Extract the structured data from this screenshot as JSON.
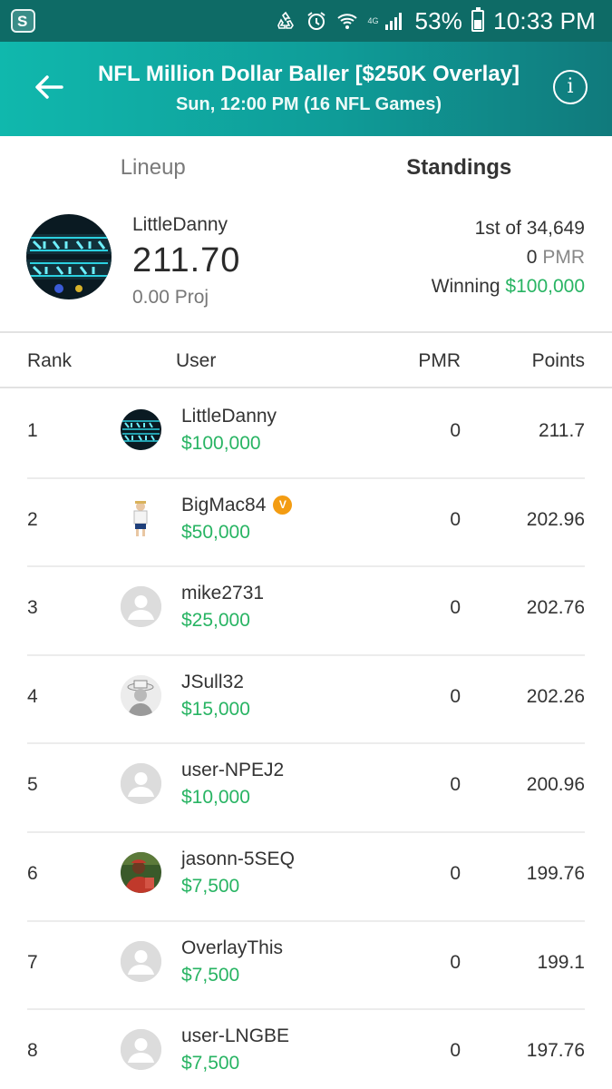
{
  "status_bar": {
    "battery": "53%",
    "time": "10:33 PM",
    "network_label": "4G",
    "icons": [
      "app-icon",
      "recycle-icon",
      "alarm-icon",
      "wifi-icon",
      "signal-icon",
      "battery-icon"
    ]
  },
  "header": {
    "title": "NFL Million Dollar Baller [$250K Overlay]",
    "subtitle": "Sun, 12:00 PM (16 NFL Games)"
  },
  "tabs": [
    {
      "label": "Lineup",
      "active": false
    },
    {
      "label": "Standings",
      "active": true
    }
  ],
  "summary": {
    "username": "LittleDanny",
    "score": "211.70",
    "proj": "0.00 Proj",
    "place": "1st of 34,649",
    "pmr_value": "0",
    "pmr_label": "PMR",
    "winning_label": "Winning",
    "winning_amount": "$100,000"
  },
  "table": {
    "headers": {
      "rank": "Rank",
      "user": "User",
      "pmr": "PMR",
      "points": "Points"
    },
    "rows": [
      {
        "rank": "1",
        "user": "LittleDanny",
        "prize": "$100,000",
        "pmr": "0",
        "points": "211.7",
        "avatar": "savage-squad-logo"
      },
      {
        "rank": "2",
        "user": "BigMac84",
        "prize": "$50,000",
        "pmr": "0",
        "points": "202.96",
        "avatar": "cartoon-player",
        "badge": "V"
      },
      {
        "rank": "3",
        "user": "mike2731",
        "prize": "$25,000",
        "pmr": "0",
        "points": "202.76",
        "avatar": "default-user"
      },
      {
        "rank": "4",
        "user": "JSull32",
        "prize": "$15,000",
        "pmr": "0",
        "points": "202.26",
        "avatar": "photo-hat"
      },
      {
        "rank": "5",
        "user": "user-NPEJ2",
        "prize": "$10,000",
        "pmr": "0",
        "points": "200.96",
        "avatar": "default-user"
      },
      {
        "rank": "6",
        "user": "jasonn-5SEQ",
        "prize": "$7,500",
        "pmr": "0",
        "points": "199.76",
        "avatar": "photo-red"
      },
      {
        "rank": "7",
        "user": "OverlayThis",
        "prize": "$7,500",
        "pmr": "0",
        "points": "199.1",
        "avatar": "default-user"
      },
      {
        "rank": "8",
        "user": "user-LNGBE",
        "prize": "$7,500",
        "pmr": "0",
        "points": "197.76",
        "avatar": "default-user"
      }
    ]
  },
  "colors": {
    "brand": "#10b8ad",
    "money": "#28b463",
    "badge": "#f39c12"
  }
}
